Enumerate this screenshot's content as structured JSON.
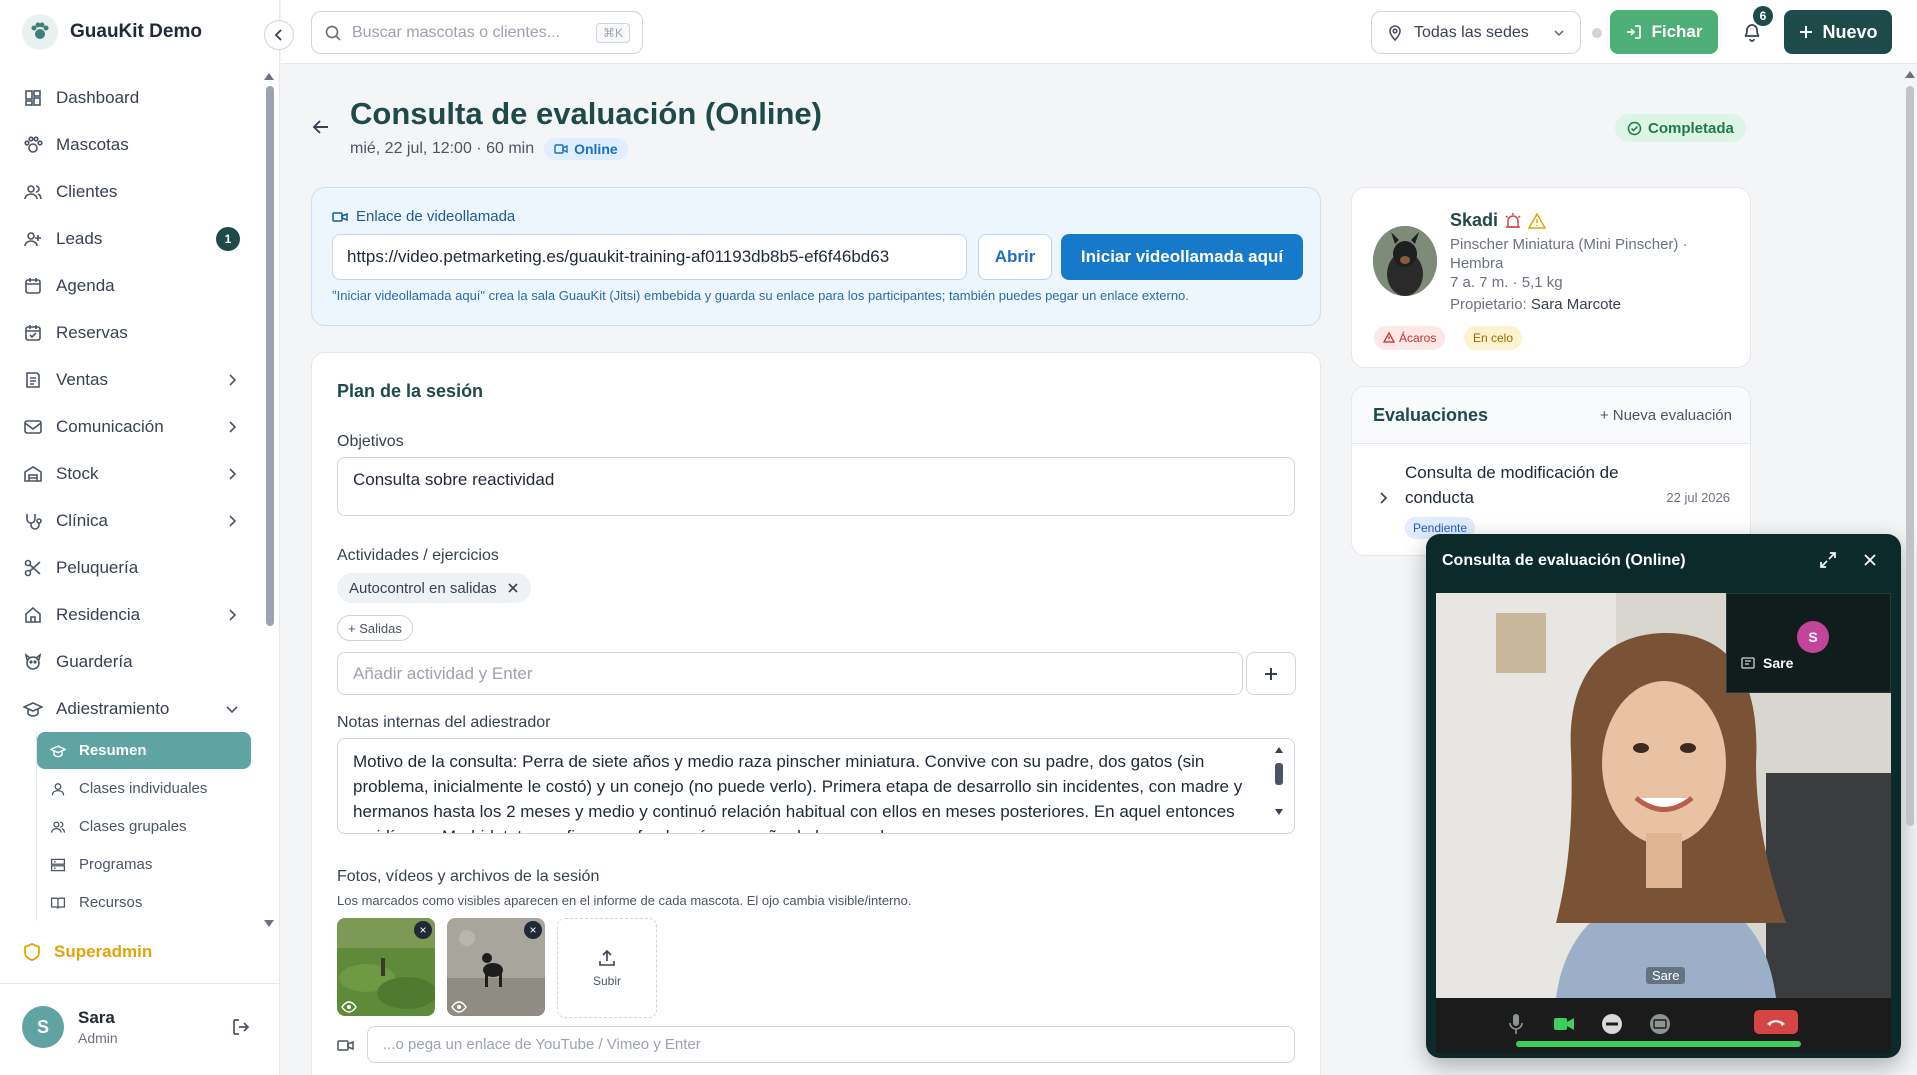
{
  "brand": {
    "name": "GuauKit Demo"
  },
  "sidebar": {
    "items": [
      {
        "label": "Dashboard",
        "icon": "dashboard-icon"
      },
      {
        "label": "Mascotas",
        "icon": "paw-icon"
      },
      {
        "label": "Clientes",
        "icon": "users-icon"
      },
      {
        "label": "Leads",
        "icon": "user-plus-icon",
        "badge": "1"
      },
      {
        "label": "Agenda",
        "icon": "calendar-icon"
      },
      {
        "label": "Reservas",
        "icon": "calendar-check-icon"
      },
      {
        "label": "Ventas",
        "icon": "receipt-icon",
        "expandable": true
      },
      {
        "label": "Comunicación",
        "icon": "mail-icon",
        "expandable": true
      },
      {
        "label": "Stock",
        "icon": "warehouse-icon",
        "expandable": true
      },
      {
        "label": "Clínica",
        "icon": "stethoscope-icon",
        "expandable": true
      },
      {
        "label": "Peluquería",
        "icon": "scissors-icon"
      },
      {
        "label": "Residencia",
        "icon": "home-icon",
        "expandable": true
      },
      {
        "label": "Guardería",
        "icon": "dog-icon"
      },
      {
        "label": "Adiestramiento",
        "icon": "graduation-cap-icon",
        "expanded": true
      }
    ],
    "sub_items": [
      {
        "label": "Resumen",
        "icon": "graduation-cap-icon",
        "active": true
      },
      {
        "label": "Clases individuales",
        "icon": "user-icon"
      },
      {
        "label": "Clases grupales",
        "icon": "users-icon"
      },
      {
        "label": "Programas",
        "icon": "list-icon"
      },
      {
        "label": "Recursos",
        "icon": "book-icon"
      }
    ],
    "superadmin_label": "Superadmin",
    "user": {
      "initial": "S",
      "name": "Sara",
      "role": "Admin"
    }
  },
  "topbar": {
    "search_placeholder": "Buscar mascotas o clientes...",
    "search_shortcut": "⌘K",
    "location_label": "Todas las sedes",
    "fichar_label": "Fichar",
    "notifications_count": "6",
    "nuevo_label": "Nuevo"
  },
  "page": {
    "title": "Consulta de evaluación (Online)",
    "meta": "mié, 22 jul, 12:00 · 60 min",
    "online_label": "Online",
    "status_label": "Completada"
  },
  "video_link": {
    "title": "Enlace de videollamada",
    "url": "https://video.petmarketing.es/guaukit-training-af01193db8b5-ef6f46bd63",
    "open_label": "Abrir",
    "start_label": "Iniciar videollamada aquí",
    "help": "\"Iniciar videollamada aquí\" crea la sala GuauKit (Jitsi) embebida y guarda su enlace para los participantes; también puedes pegar un enlace externo."
  },
  "plan": {
    "title": "Plan de la sesión",
    "objectives_label": "Objetivos",
    "objectives_value": "Consulta sobre reactividad",
    "activities_label": "Actividades / ejercicios",
    "activity_chip": "Autocontrol en salidas",
    "suggestion_chip": "+ Salidas",
    "add_activity_placeholder": "Añadir actividad y Enter",
    "notes_label": "Notas internas del adiestrador",
    "notes_value": "Motivo de la consulta: Perra de siete años y medio raza pinscher miniatura. Convive con su padre, dos gatos (sin problema, inicialmente le costó) y un conejo (no puede verlo). Primera etapa de desarrollo sin incidentes, con madre y hermanos hasta los 2 meses y medio y continuó relación habitual con ellos en meses posteriores. En aquel entonces residían en Madrid, tutora refiere que fue la más pequeña de la camada y se",
    "media_label": "Fotos, vídeos y archivos de la sesión",
    "media_help": "Los marcados como visibles aparecen en el informe de cada mascota. El ojo cambia visible/interno.",
    "upload_label": "Subir",
    "video_url_placeholder": "...o pega un enlace de YouTube / Vimeo y Enter"
  },
  "pet": {
    "name": "Skadi",
    "breed": "Pinscher Miniatura (Mini Pinscher) · Hembra",
    "age_weight": "7 a. 7 m. · 5,1 kg",
    "owner_prefix": "Propietario:",
    "owner_name": "Sara Marcote",
    "tags": [
      "Ácaros",
      "En celo"
    ]
  },
  "evaluations": {
    "title": "Evaluaciones",
    "new_label": "+ Nueva evaluación",
    "item_name": "Consulta de modificación de conducta",
    "item_date": "22 jul 2026",
    "item_status": "Pendiente"
  },
  "video_call": {
    "title": "Consulta de evaluación (Online)",
    "pip_initial": "S",
    "pip_name": "Sare",
    "speaker_name": "Sare"
  },
  "colors": {
    "primary": "#1f4a4a",
    "accent_teal": "#5fa3a3",
    "fichar_green": "#4caf78",
    "call_blue": "#1779c9",
    "superadmin_amber": "#e3a30a"
  }
}
